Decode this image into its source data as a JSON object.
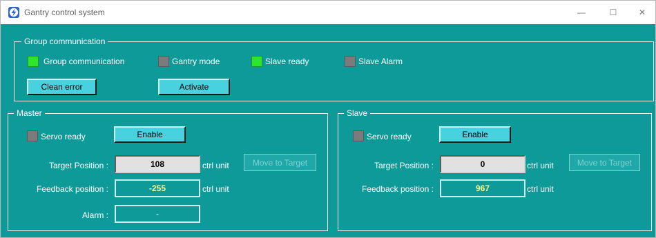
{
  "window": {
    "title": "Gantry control system",
    "controls": {
      "minimize": "—",
      "maximize": "☐",
      "close": "✕"
    }
  },
  "group": {
    "legend": "Group communication",
    "indicators": [
      {
        "label": "Group communication",
        "state": "on"
      },
      {
        "label": "Gantry mode",
        "state": "off"
      },
      {
        "label": "Slave ready",
        "state": "on"
      },
      {
        "label": "Slave Alarm",
        "state": "off"
      }
    ],
    "clean_error_label": "Clean error",
    "activate_label": "Activate"
  },
  "master": {
    "legend": "Master",
    "servo_ready_label": "Servo ready",
    "servo_ready_state": "off",
    "enable_label": "Enable",
    "target_label": "Target Position :",
    "target_value": "108",
    "target_unit": "ctrl unit",
    "move_label": "Move to Target",
    "feedback_label": "Feedback position :",
    "feedback_value": "-255",
    "feedback_unit": "ctrl unit",
    "alarm_label": "Alarm :",
    "alarm_value": "-"
  },
  "slave": {
    "legend": "Slave",
    "servo_ready_label": "Servo ready",
    "servo_ready_state": "off",
    "enable_label": "Enable",
    "target_label": "Target Position :",
    "target_value": "0",
    "target_unit": "ctrl unit",
    "move_label": "Move to Target",
    "feedback_label": "Feedback position :",
    "feedback_value": "967",
    "feedback_unit": "ctrl unit"
  },
  "colors": {
    "panel": "#0f9a9a",
    "indicator_on": "#2ee52e",
    "indicator_off": "#7b7b7b",
    "button": "#48d2df",
    "readout_text": "#ffff88"
  }
}
